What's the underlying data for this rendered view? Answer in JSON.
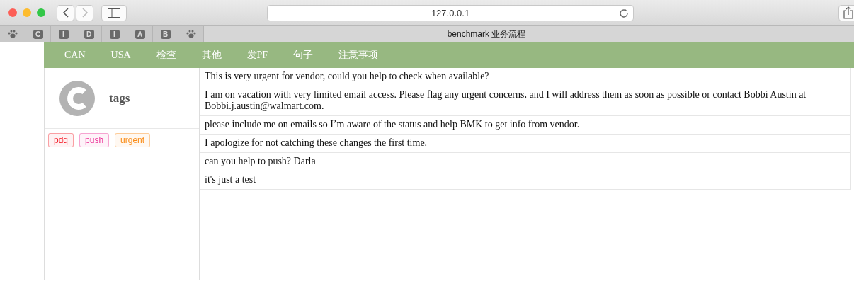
{
  "browser": {
    "address": "127.0.0.1",
    "bookmarks": [
      {
        "kind": "paw"
      },
      {
        "kind": "letter",
        "label": "C"
      },
      {
        "kind": "letter",
        "label": "I"
      },
      {
        "kind": "letter",
        "label": "D"
      },
      {
        "kind": "letter",
        "label": "I"
      },
      {
        "kind": "letter",
        "label": "A"
      },
      {
        "kind": "letter",
        "label": "B"
      },
      {
        "kind": "paw"
      }
    ],
    "tab_title": "benchmark 业务流程"
  },
  "nav": [
    "CAN",
    "USA",
    "检查",
    "其他",
    "发PF",
    "句子",
    "注意事项"
  ],
  "sidebar": {
    "title": "tags",
    "tags": [
      {
        "label": "pdq",
        "color": "#f5222d"
      },
      {
        "label": "push",
        "color": "#eb2f96"
      },
      {
        "label": "urgent",
        "color": "#fa8c16"
      }
    ]
  },
  "messages": [
    "This is very urgent for vendor, could you help to check when available?",
    "I am on vacation with very limited email access. Please flag any urgent concerns, and I will address them as soon as possible or contact Bobbi Austin at Bobbi.j.austin@walmart.com.",
    "please include me on emails so I’m aware of the status and help BMK to get info from vendor.",
    "I apologize for not catching these changes the first time.",
    "can you help to push? Darla",
    "it's just a test"
  ]
}
